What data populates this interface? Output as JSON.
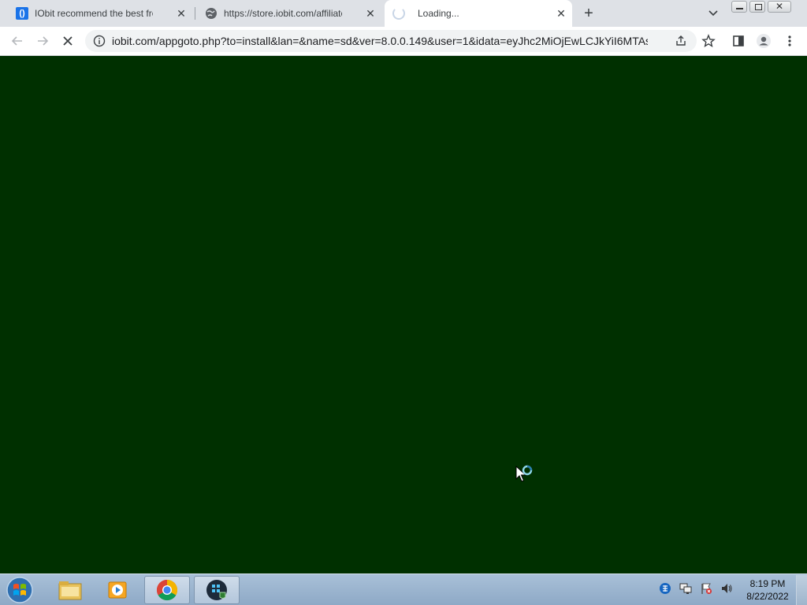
{
  "tabs": [
    {
      "title": "IObit recommend the best free c",
      "icon": "iobit-icon"
    },
    {
      "title": "https://store.iobit.com/affiliate.ph",
      "icon": "globe-icon"
    },
    {
      "title": "Loading...",
      "icon": "loading-spinner-icon"
    }
  ],
  "address_bar": {
    "url": "iobit.com/appgoto.php?to=install&lan=&name=sd&ver=8.0.0.149&user=1&idata=eyJhc2MiOjEwLCJkYiI6MTAsI..."
  },
  "page": {
    "background_color": "#003000"
  },
  "taskbar": {
    "apps": [
      "windows-explorer",
      "media-player",
      "chrome",
      "iobit-installer"
    ],
    "clock_time": "8:19 PM",
    "clock_date": "8/22/2022"
  }
}
